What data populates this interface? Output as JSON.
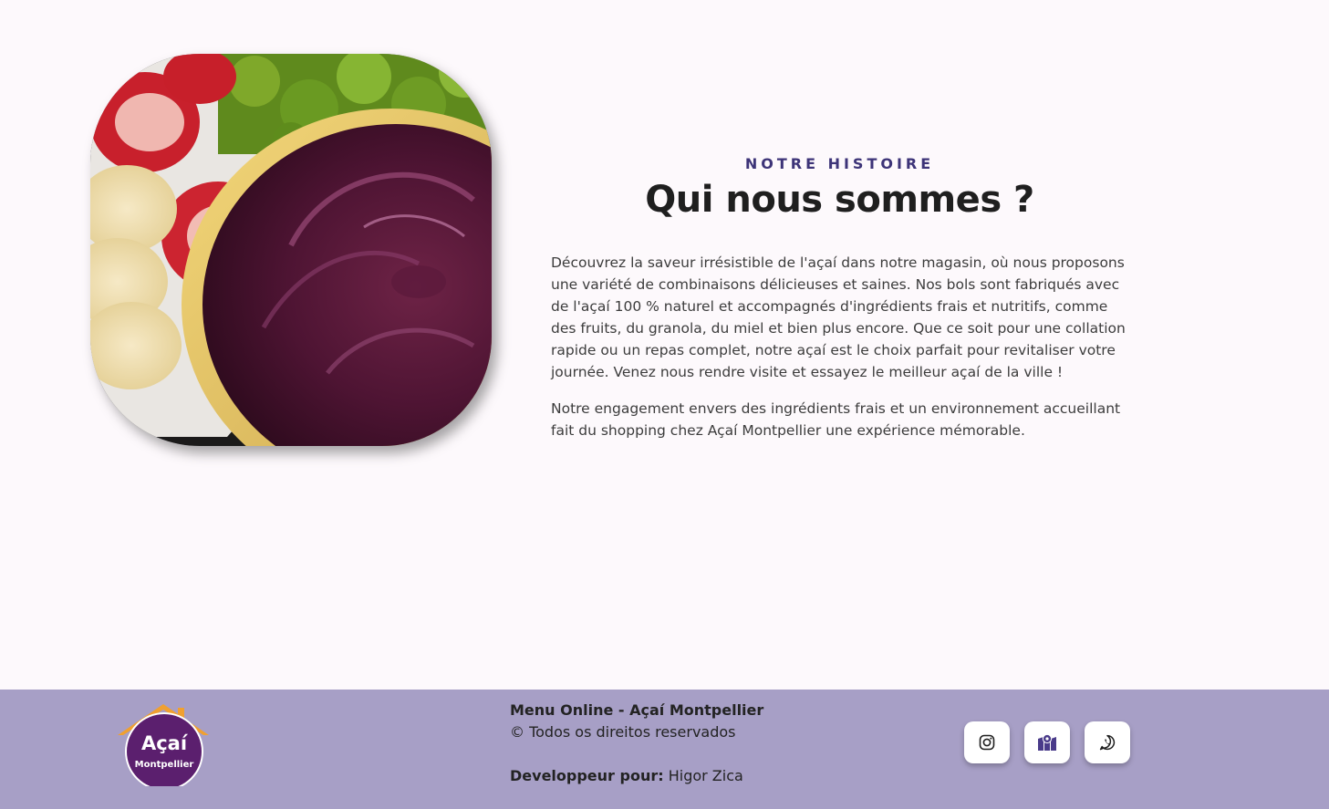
{
  "about": {
    "eyebrow": "NOTRE HISTOIRE",
    "title": "Qui nous sommes ?",
    "paragraph_1": "Découvrez la saveur irrésistible de l'açaí dans notre magasin, où nous proposons une variété de combinaisons délicieuses et saines. Nos bols sont fabriqués avec de l'açaí 100 % naturel et accompagnés d'ingrédients frais et nutritifs, comme des fruits, du granola, du miel et bien plus encore. Que ce soit pour une collation rapide ou un repas complet, notre açaí est le choix parfait pour revitaliser votre journée. Venez nous rendre visite et essayez le meilleur açaí de la ville !",
    "paragraph_2": "Notre engagement envers des ingrédients frais et un environnement accueillant fait du shopping chez Açaí Montpellier une expérience mémorable."
  },
  "footer": {
    "logo_line_1": "Açaí",
    "logo_line_2": "Montpellier",
    "site_name": "Menu Online - Açaí Montpellier",
    "copyright": "© Todos os direitos reservados",
    "dev_label": "Developpeur pour:",
    "dev_name": " Higor Zica",
    "social": [
      {
        "icon": "instagram-icon"
      },
      {
        "icon": "map-icon"
      },
      {
        "icon": "whatsapp-icon"
      }
    ]
  },
  "colors": {
    "background": "#fdf9fc",
    "footer": "#a79fc6",
    "accent": "#3d3478",
    "logo_purple": "#5b1f6e",
    "logo_orange": "#f0a030"
  }
}
